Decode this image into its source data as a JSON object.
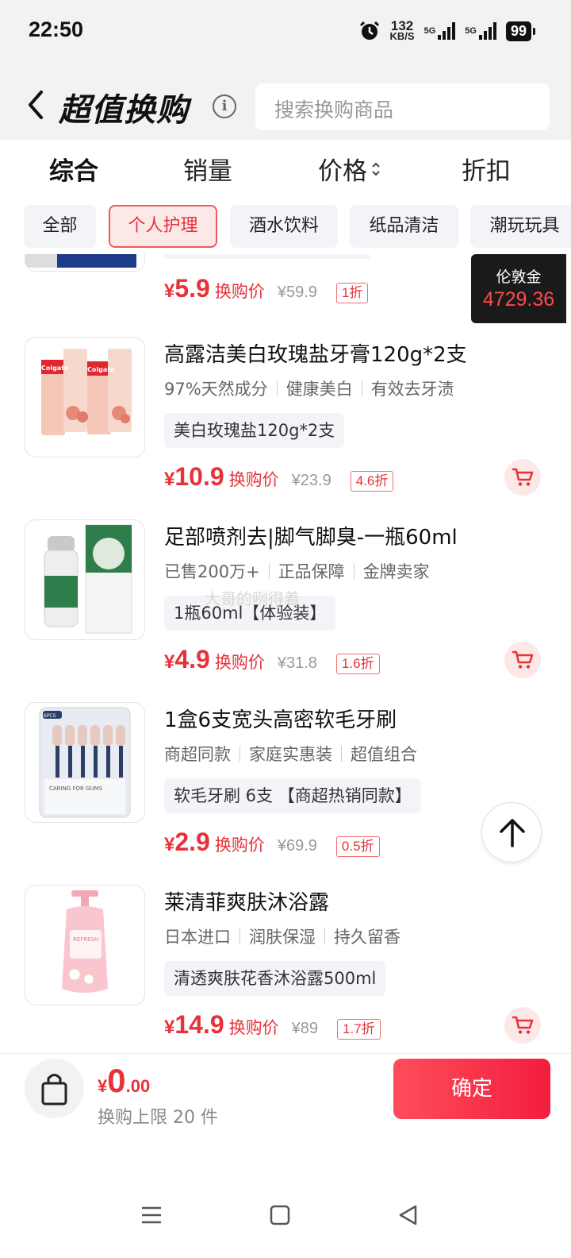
{
  "status_bar": {
    "time": "22:50",
    "net_speed_value": "132",
    "net_speed_unit": "KB/S",
    "signal1_label": "5G",
    "signal2_label": "5G",
    "battery": "99"
  },
  "header": {
    "title": "超值换购",
    "search_placeholder": "搜索换购商品"
  },
  "sort_tabs": [
    "综合",
    "销量",
    "价格",
    "折扣"
  ],
  "categories": [
    {
      "label": "全部",
      "active": false
    },
    {
      "label": "个人护理",
      "active": true
    },
    {
      "label": "酒水饮料",
      "active": false
    },
    {
      "label": "纸品清洁",
      "active": false
    },
    {
      "label": "潮玩玩具",
      "active": false
    }
  ],
  "balance": {
    "label": "伦敦金",
    "value": "4729.36"
  },
  "items": [
    {
      "title": "",
      "price_symbol": "¥",
      "price": "5.9",
      "price_label": "换购价",
      "original_price": "¥59.9",
      "discount": "1折"
    },
    {
      "title": "高露洁美白玫瑰盐牙膏120g*2支",
      "tags": [
        "97%天然成分",
        "健康美白",
        "有效去牙渍"
      ],
      "spec": "美白玫瑰盐120g*2支",
      "price_symbol": "¥",
      "price": "10.9",
      "price_label": "换购价",
      "original_price": "¥23.9",
      "discount": "4.6折"
    },
    {
      "title": "足部喷剂去|脚气脚臭-一瓶60ml",
      "tags": [
        "已售200万+",
        "正品保障",
        "金牌卖家"
      ],
      "spec": "1瓶60ml【体验装】",
      "price_symbol": "¥",
      "price": "4.9",
      "price_label": "换购价",
      "original_price": "¥31.8",
      "discount": "1.6折"
    },
    {
      "title": "1盒6支宽头高密软毛牙刷",
      "tags": [
        "商超同款",
        "家庭实惠装",
        "超值组合"
      ],
      "spec": "软毛牙刷 6支 【商超热销同款】",
      "price_symbol": "¥",
      "price": "2.9",
      "price_label": "换购价",
      "original_price": "¥69.9",
      "discount": "0.5折"
    },
    {
      "title": "莱清菲爽肤沐浴露",
      "tags": [
        "日本进口",
        "润肤保湿",
        "持久留香"
      ],
      "spec": "清透爽肤花香沐浴露500ml",
      "price_symbol": "¥",
      "price": "14.9",
      "price_label": "换购价",
      "original_price": "¥89",
      "discount": "1.7折"
    }
  ],
  "product_art_text": {
    "toothpaste_brand": "Colgate",
    "toothbrush_pack": "6PCS",
    "toothbrush_box_text": "CARING FOR GUMS",
    "bodywash_brand": "REFRESH"
  },
  "watermark": "大哥的咧得着",
  "bottom_bar": {
    "total_symbol": "¥",
    "total_int": "0",
    "total_dec": ".00",
    "limit": "换购上限 20 件",
    "confirm": "确定"
  },
  "colors": {
    "accent": "#e8323a",
    "header_bg": "#f2f2f2",
    "chip_bg": "#f3f4f8",
    "balance_bg": "#1a1a1a"
  },
  "icons": [
    "back-arrow-icon",
    "info-icon",
    "sort-arrows-icon",
    "cart-icon",
    "arrow-up-icon",
    "shopping-bag-icon",
    "menu-icon",
    "home-square-icon",
    "back-triangle-icon",
    "alarm-icon"
  ]
}
